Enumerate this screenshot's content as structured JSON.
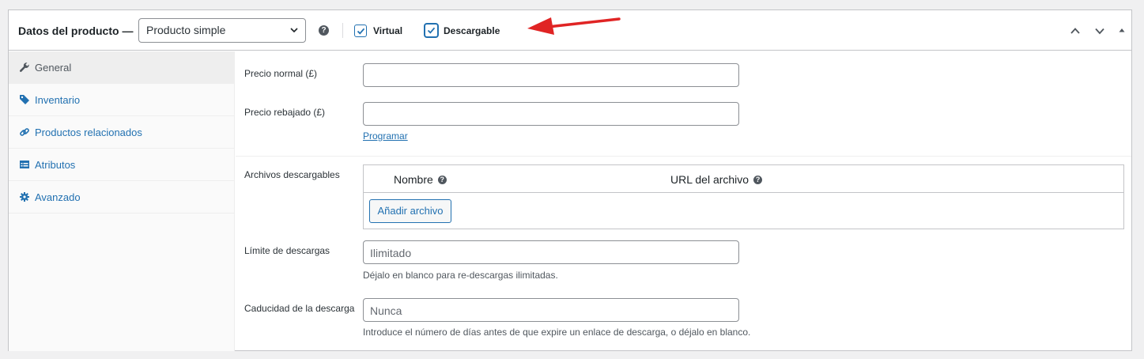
{
  "header": {
    "title": "Datos del producto —",
    "product_type": "Producto simple",
    "virtual_label": "Virtual",
    "downloadable_label": "Descargable",
    "virtual_checked": true,
    "downloadable_checked": true
  },
  "sidebar": {
    "items": [
      {
        "label": "General",
        "icon": "wrench-icon",
        "active": true
      },
      {
        "label": "Inventario",
        "icon": "tag-icon",
        "active": false
      },
      {
        "label": "Productos relacionados",
        "icon": "link-icon",
        "active": false
      },
      {
        "label": "Atributos",
        "icon": "table-icon",
        "active": false
      },
      {
        "label": "Avanzado",
        "icon": "gear-icon",
        "active": false
      }
    ]
  },
  "general": {
    "regular_price_label": "Precio normal (£)",
    "regular_price_value": "",
    "sale_price_label": "Precio rebajado (£)",
    "sale_price_value": "",
    "schedule_link": "Programar",
    "downloadable_files_label": "Archivos descargables",
    "col_name": "Nombre",
    "col_url": "URL del archivo",
    "add_file_button": "Añadir archivo",
    "download_limit_label": "Límite de descargas",
    "download_limit_placeholder": "Ilimitado",
    "download_limit_desc": "Déjalo en blanco para re-descargas ilimitadas.",
    "download_expiry_label": "Caducidad de la descarga",
    "download_expiry_placeholder": "Nunca",
    "download_expiry_desc": "Introduce el número de días antes de que expire un enlace de descarga, o déjalo en blanco."
  },
  "colors": {
    "accent": "#2271b1",
    "arrow": "#e02424",
    "border": "#c3c4c7"
  }
}
